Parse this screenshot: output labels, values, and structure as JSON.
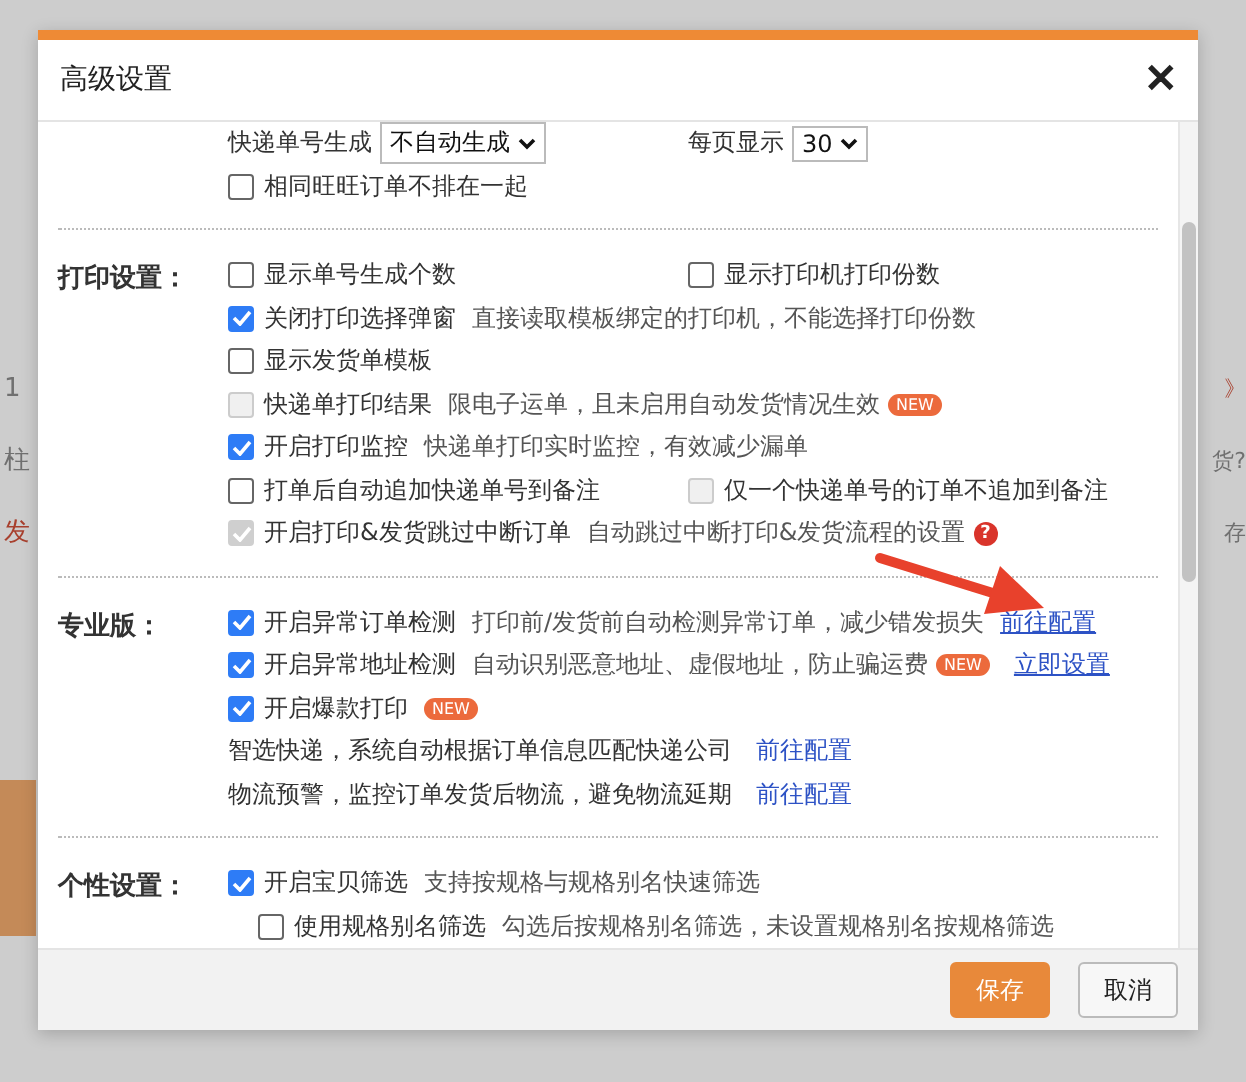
{
  "background": {
    "left": [
      {
        "text": "1",
        "kind": "plain"
      },
      {
        "text": "柱",
        "kind": "plain"
      },
      {
        "text": "发",
        "kind": "alert"
      }
    ],
    "right": [
      {
        "text": "》",
        "kind": "alert"
      },
      {
        "text": "货?",
        "kind": "plain"
      },
      {
        "text": "存",
        "kind": "plain"
      }
    ]
  },
  "dialog": {
    "title": "高级设置",
    "close": "✕"
  },
  "sections": [
    {
      "rows": [
        {
          "items": [
            {
              "kind": "select",
              "label": "快递单号生成",
              "value": "不自动生成"
            },
            {
              "kind": "select",
              "label": "每页显示",
              "value": "30"
            }
          ]
        },
        {
          "items": [
            {
              "kind": "checkbox",
              "label": "相同旺旺订单不排在一起",
              "checked": false,
              "disabled": false
            }
          ]
        }
      ]
    },
    {
      "label": "打印设置：",
      "rows": [
        {
          "items": [
            {
              "kind": "checkbox",
              "label": "显示单号生成个数",
              "checked": false,
              "disabled": false
            },
            {
              "kind": "checkbox",
              "label": "显示打印机打印份数",
              "checked": false,
              "disabled": false
            }
          ]
        },
        {
          "items": [
            {
              "kind": "checkbox",
              "label": "关闭打印选择弹窗",
              "hint": "直接读取模板绑定的打印机，不能选择打印份数",
              "checked": true,
              "disabled": false
            }
          ]
        },
        {
          "items": [
            {
              "kind": "checkbox",
              "label": "显示发货单模板",
              "checked": false,
              "disabled": false
            }
          ]
        },
        {
          "items": [
            {
              "kind": "checkbox",
              "label": "快递单打印结果",
              "hint": "限电子运单，且未启用自动发货情况生效",
              "badge": "NEW",
              "checked": false,
              "disabled": true
            }
          ]
        },
        {
          "items": [
            {
              "kind": "checkbox",
              "label": "开启打印监控",
              "hint": "快递单打印实时监控，有效减少漏单",
              "checked": true,
              "disabled": false
            }
          ]
        },
        {
          "items": [
            {
              "kind": "checkbox",
              "label": "打单后自动追加快递单号到备注",
              "checked": false,
              "disabled": false
            },
            {
              "kind": "checkbox",
              "label": "仅一个快递单号的订单不追加到备注",
              "checked": false,
              "disabled": true
            }
          ]
        },
        {
          "items": [
            {
              "kind": "checkbox",
              "label": "开启打印&发货跳过中断订单",
              "hint": "自动跳过中断打印&发货流程的设置",
              "help": "?",
              "checked": true,
              "disabled": true
            }
          ]
        }
      ]
    },
    {
      "label": "专业版：",
      "rows": [
        {
          "items": [
            {
              "kind": "checkbox",
              "label": "开启异常订单检测",
              "hint": "打印前/发货前自动检测异常订单，减少错发损失",
              "link": "前往配置",
              "checked": true,
              "disabled": false
            }
          ]
        },
        {
          "items": [
            {
              "kind": "checkbox",
              "label": "开启异常地址检测",
              "hint": "自动识别恶意地址、虚假地址，防止骗运费",
              "badge": "NEW",
              "link": "立即设置",
              "checked": true,
              "disabled": false
            }
          ]
        },
        {
          "items": [
            {
              "kind": "checkbox",
              "label": "开启爆款打印",
              "badge": "NEW",
              "checked": true,
              "disabled": false
            }
          ]
        },
        {
          "items": [
            {
              "kind": "text",
              "label": "智选快递，系统自动根据订单信息匹配快递公司",
              "link": "前往配置"
            }
          ]
        },
        {
          "items": [
            {
              "kind": "text",
              "label": "物流预警，监控订单发货后物流，避免物流延期",
              "link": "前往配置"
            }
          ]
        }
      ]
    },
    {
      "label": "个性设置：",
      "rows": [
        {
          "items": [
            {
              "kind": "checkbox",
              "label": "开启宝贝筛选",
              "hint": "支持按规格与规格别名快速筛选",
              "checked": true,
              "disabled": false
            }
          ],
          "children": [
            {
              "items": [
                {
                  "kind": "checkbox",
                  "label": "使用规格别名筛选",
                  "hint": "勾选后按规格别名筛选，未设置规格别名按规格筛选",
                  "checked": false,
                  "disabled": false
                }
              ]
            }
          ]
        }
      ]
    }
  ],
  "buttons": [
    {
      "label": "保存",
      "kind": "primary"
    },
    {
      "label": "取消",
      "kind": "secondary"
    }
  ]
}
